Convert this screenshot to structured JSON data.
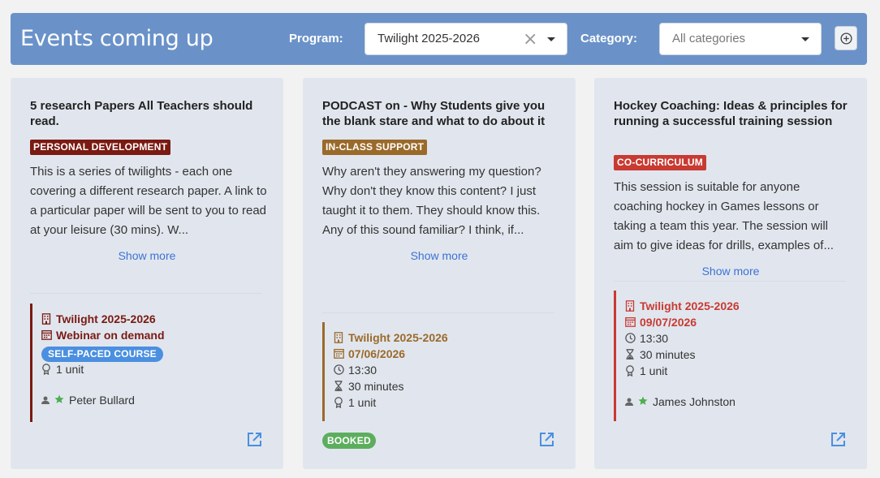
{
  "header": {
    "title": "Events coming up",
    "program_label": "Program:",
    "program_value": "Twilight 2025-2026",
    "category_label": "Category:",
    "category_placeholder": "All categories"
  },
  "colors": {
    "header_bg": "#6a92c9",
    "personal_development": "#7a1a12",
    "in_class_support": "#9a6a2a",
    "co_curriculum": "#c83a32",
    "self_paced": "#4a8fe0",
    "booked": "#5cae5e",
    "link": "#3c72d4"
  },
  "cards": [
    {
      "title": "5 research Papers All Teachers should read.",
      "tag": "PERSONAL DEVELOPMENT",
      "description": "This is a series of twilights - each one covering a different research paper. A link to a particular paper will be sent to you to read at your leisure (30 mins). W...",
      "show_more": "Show more",
      "program": "Twilight 2025-2026",
      "date": "Webinar on demand",
      "badge": "SELF-PACED COURSE",
      "units": "1 unit",
      "person": "Peter Bullard"
    },
    {
      "title": "PODCAST on - Why Students give you the blank stare and what to do about it",
      "tag": "IN-CLASS SUPPORT",
      "description": "Why aren't they answering my question? Why don't they know this content? I just taught it to them. They should know this. Any of this sound familiar? I think, if...",
      "show_more": "Show more",
      "program": "Twilight 2025-2026",
      "date": "07/06/2026",
      "time": "13:30",
      "duration": "30 minutes",
      "units": "1 unit",
      "status": "BOOKED"
    },
    {
      "title": "Hockey Coaching: Ideas & principles for running a successful training session",
      "tag": "CO-CURRICULUM",
      "description": "This session is suitable for anyone coaching hockey in Games lessons or taking a team this year. The session will aim to give ideas for drills, examples of...",
      "show_more": "Show more",
      "program": "Twilight 2025-2026",
      "date": "09/07/2026",
      "time": "13:30",
      "duration": "30 minutes",
      "units": "1 unit",
      "person": "James Johnston"
    }
  ]
}
